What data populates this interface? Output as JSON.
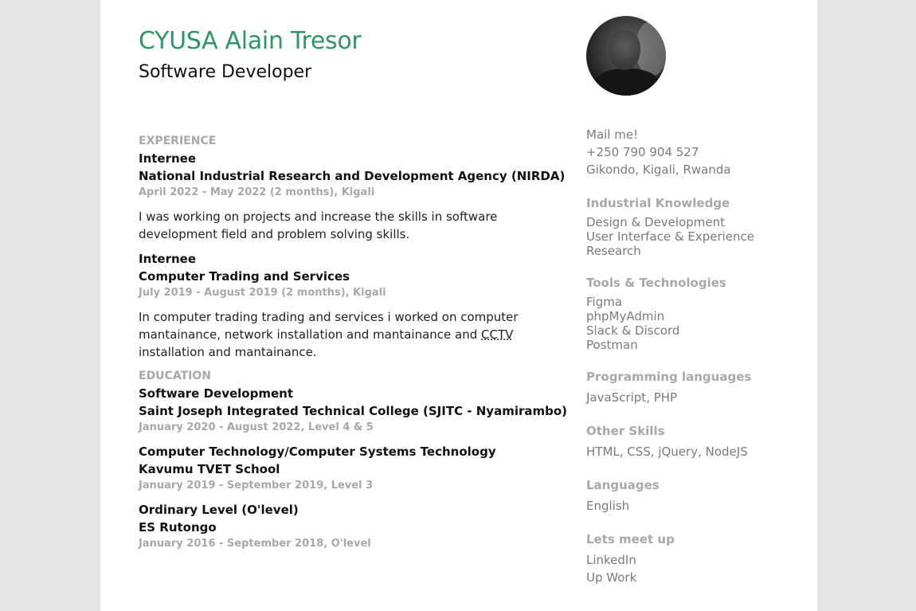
{
  "header": {
    "name": "CYUSA Alain Tresor",
    "role": "Software Developer"
  },
  "experience": {
    "title": "EXPERIENCE",
    "items": [
      {
        "position": "Internee",
        "org": "National Industrial Research and Development Agency (NIRDA)",
        "meta": "April 2022 - May 2022 (2 months), Kigali",
        "desc": "I was working on projects and increase the skills in software development field and problem solving skills."
      },
      {
        "position": "Internee",
        "org": "Computer Trading and Services",
        "meta": "July 2019 - August 2019 (2 months), Kigali",
        "desc_before": "In computer trading trading and services i worked on computer mantainance, network installation and mantainance and ",
        "desc_abbr": "CCTV",
        "desc_after": " installation and mantainance."
      }
    ]
  },
  "education": {
    "title": "EDUCATION",
    "items": [
      {
        "program": "Software Development",
        "school": "Saint Joseph Integrated Technical College (SJITC - Nyamirambo)",
        "meta": "January 2020 - August 2022, Level 4 & 5"
      },
      {
        "program": "Computer Technology/Computer Systems Technology",
        "school": "Kavumu TVET School",
        "meta": "January 2019 - September 2019, Level 3"
      },
      {
        "program": "Ordinary Level (O'level)",
        "school": "ES Rutongo",
        "meta": "January 2016 - September 2018, O'level"
      }
    ]
  },
  "contact": {
    "mail": "Mail me!",
    "phone": "+250 790 904 527",
    "address": "Gikondo, Kigali, Rwanda"
  },
  "sidebar": {
    "industrial": {
      "title": "Industrial Knowledge",
      "items": [
        "Design & Development",
        "User Interface & Experience",
        "Research"
      ]
    },
    "tools": {
      "title": "Tools & Technologies",
      "items": [
        "Figma",
        "phpMyAdmin",
        "Slack & Discord",
        "Postman"
      ]
    },
    "programming": {
      "title": "Programming languages",
      "value": "JavaScript, PHP"
    },
    "other": {
      "title": "Other Skills",
      "value": "HTML, CSS, jQuery, NodeJS"
    },
    "languages": {
      "title": "Languages",
      "value": "English"
    },
    "meet": {
      "title": "Lets meet up",
      "links": [
        "LinkedIn",
        "Up Work"
      ]
    }
  },
  "colors": {
    "accent": "#2e9569",
    "muted": "#a8a8a8",
    "page_bg": "#e6e6e6"
  }
}
